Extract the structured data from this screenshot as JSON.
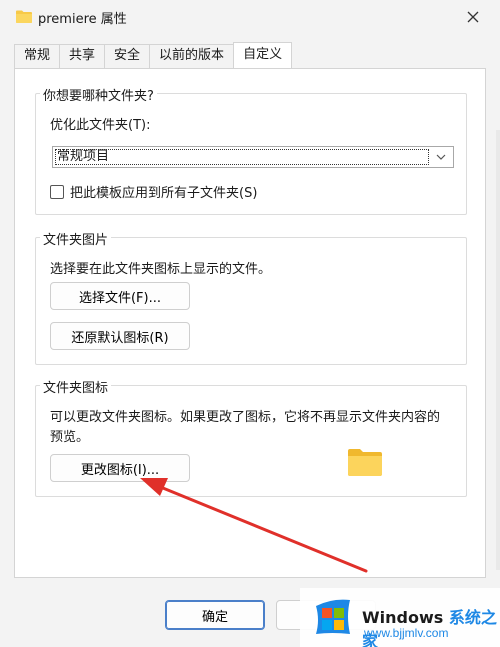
{
  "window": {
    "title": "premiere 属性",
    "close_icon": "close-icon"
  },
  "tabs": [
    {
      "label": "常规",
      "active": false
    },
    {
      "label": "共享",
      "active": false
    },
    {
      "label": "安全",
      "active": false
    },
    {
      "label": "以前的版本",
      "active": false
    },
    {
      "label": "自定义",
      "active": true
    }
  ],
  "optimize": {
    "heading": "你想要哪种文件夹?",
    "label": "优化此文件夹(T):",
    "selected": "常规项目",
    "checkbox_label": "把此模板应用到所有子文件夹(S)",
    "checked": false
  },
  "folder_picture": {
    "heading": "文件夹图片",
    "description": "选择要在此文件夹图标上显示的文件。",
    "choose_button": "选择文件(F)...",
    "restore_button": "还原默认图标(R)"
  },
  "folder_icon": {
    "heading": "文件夹图标",
    "description_line1": "可以更改文件夹图标。如果更改了图标，它将不再显示文件夹内容的",
    "description_line2": "预览。",
    "change_button": "更改图标(I)..."
  },
  "footer": {
    "ok_button": "确定"
  },
  "watermark": {
    "title_part1": "Windows",
    "title_part2": "系统之家",
    "url": "www.bjjmlv.com"
  },
  "colors": {
    "folder_yellow": "#f7c948",
    "accent_blue": "#1e88e5",
    "annotation_red": "#e0302a"
  }
}
